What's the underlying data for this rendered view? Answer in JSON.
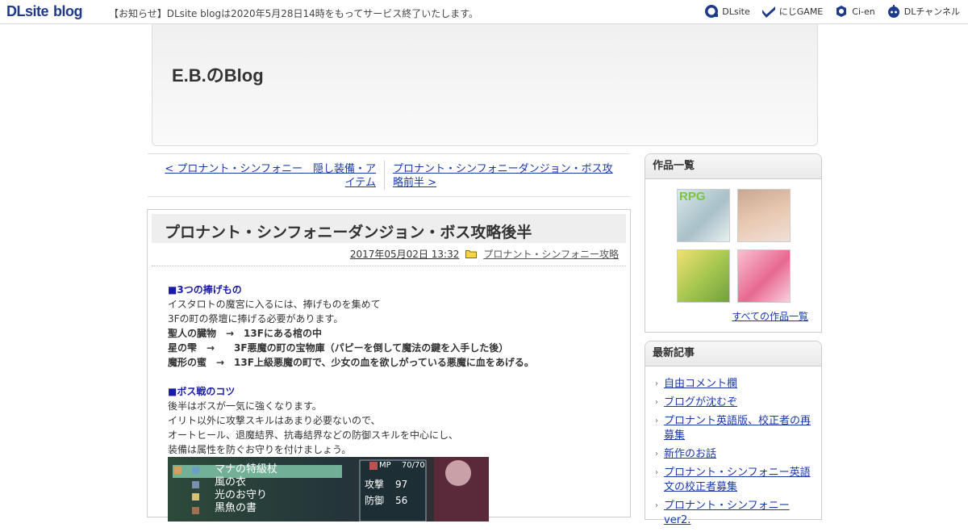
{
  "topbar": {
    "logo_main": "DLsite",
    "logo_sub": "blog",
    "notice": "【お知らせ】DLsite blogは2020年5月28日14時をもってサービス終了いたします。",
    "links": [
      {
        "label": "DLsite",
        "icon": "dl-icon"
      },
      {
        "label": "にじGAME",
        "icon": "niji-icon"
      },
      {
        "label": "Ci-en",
        "icon": "cien-icon"
      },
      {
        "label": "DLチャンネル",
        "icon": "channel-icon"
      }
    ]
  },
  "header": {
    "title": "E.B.のBlog"
  },
  "nav": {
    "prev": "< プロナント・シンフォニー　隠し装備・アイテム",
    "next": "プロナント・シンフォニーダンジョン・ボス攻略前半 >"
  },
  "article": {
    "title": "プロナント・シンフォニーダンジョン・ボス攻略後半",
    "date": "2017年05月02日 13:32",
    "category": "プロナント・シンフォニー攻略",
    "lines": [
      {
        "text": "■3つの捧げもの",
        "style": "hd"
      },
      {
        "text": "イスタロトの魔宮に入るには、捧げものを集めて",
        "style": ""
      },
      {
        "text": "3Fの町の祭壇に捧げる必要があります。",
        "style": ""
      },
      {
        "text": "聖人の臓物　→　13Fにある棺の中",
        "style": "b"
      },
      {
        "text": "星の雫　→　　3F悪魔の町の宝物庫（パピーを倒して魔法の鍵を入手した後）",
        "style": "b"
      },
      {
        "text": "魔形の蜜　→　13F上級悪魔の町で、少女の血を欲しがっている悪魔に血をあげる。",
        "style": "b"
      },
      {
        "text": "",
        "style": ""
      },
      {
        "text": "■ボス戦のコツ",
        "style": "hd"
      },
      {
        "text": "後半はボスが一気に強くなります。",
        "style": ""
      },
      {
        "text": "イリト以外に攻撃スキルはあまり必要ないので、",
        "style": ""
      },
      {
        "text": "オートヒール、退魔結界、抗毒結界などの防御スキルを中心にし、",
        "style": ""
      },
      {
        "text": "装備は属性を防ぐお守りを付けましょう。",
        "style": ""
      }
    ],
    "screenshot": {
      "items": [
        "マナの特級杖",
        "風の衣",
        "光のお守り",
        "黒魚の書"
      ],
      "mp_label": "MP",
      "mp": "70/70",
      "stats": [
        {
          "label": "攻撃",
          "value": "97"
        },
        {
          "label": "防御",
          "value": "56"
        }
      ]
    }
  },
  "sidebar": {
    "works_title": "作品一覧",
    "works_badge": "RPG",
    "all_works": "すべての作品一覧",
    "recent_title": "最新記事",
    "recent": [
      "自由コメント欄",
      "ブログが沈むぞ",
      "プロナント英語版、校正者の再募集",
      "新作のお話",
      "プロナント・シンフォニー英語文の校正者募集",
      "プロナント・シンフォニーver2."
    ]
  }
}
